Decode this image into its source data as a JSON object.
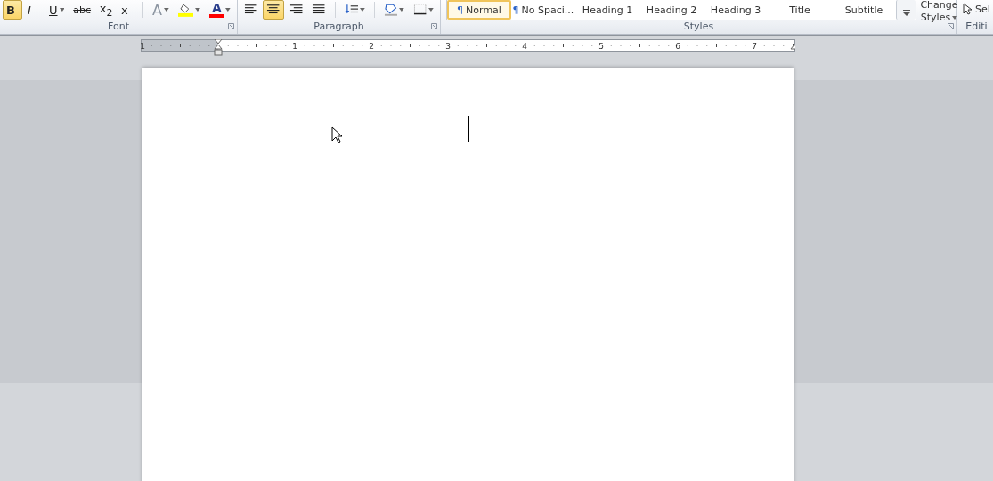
{
  "ribbon": {
    "groups": [
      {
        "kind": "font",
        "label": "Font",
        "buttons": [
          {
            "kind": "text",
            "text": "B",
            "selected": true,
            "dropdown": false
          },
          {
            "kind": "text",
            "text": "I",
            "selected": false,
            "dropdown": false
          },
          {
            "kind": "text",
            "text": "U",
            "selected": false,
            "dropdown": true
          },
          {
            "kind": "text",
            "text": "abc",
            "selected": false,
            "dropdown": false
          },
          {
            "kind": "text",
            "text": "x$_{2}$",
            "selected": false,
            "dropdown": false
          },
          {
            "kind": "text",
            "text": "x",
            "selected": false,
            "dropdown": false
          },
          {
            "kind": "effects",
            "text": "A",
            "selected": false,
            "dropdown": true
          },
          {
            "kind": "highlight",
            "selected": false,
            "dropdown": true
          },
          {
            "kind": "color",
            "text": "A",
            "selected": false,
            "dropdown": true
          }
        ]
      },
      {
        "kind": "paragraph",
        "label": "Paragraph",
        "buttons": [
          {
            "kind": "left",
            "selected": false,
            "dropdown": false
          },
          {
            "kind": "center",
            "selected": true,
            "dropdown": false
          },
          {
            "kind": "right",
            "selected": false,
            "dropdown": false
          },
          {
            "kind": "justify",
            "selected": false,
            "dropdown": false
          },
          {
            "kind": "spacing",
            "selected": false,
            "dropdown": true
          },
          {
            "kind": "shading",
            "selected": false,
            "dropdown": true
          },
          {
            "kind": "borders",
            "selected": false,
            "dropdown": true
          }
        ]
      },
      {
        "kind": "styles",
        "label": "Styles",
        "gallery": [
          {
            "symbol": "¶",
            "label": "Normal",
            "selected": true
          },
          {
            "symbol": "¶",
            "label": "No Spaci...",
            "selected": false
          },
          {
            "label": "Heading 1",
            "selected": false
          },
          {
            "label": "Heading 2",
            "selected": false
          },
          {
            "label": "Heading 3",
            "selected": false
          },
          {
            "label": "Title",
            "selected": false
          },
          {
            "label": "Subtitle",
            "selected": false
          }
        ],
        "change_styles": {
          "line_1": "Change",
          "line_2": "Styles"
        }
      },
      {
        "kind": "editing",
        "label": "Editi",
        "select": "Sel"
      }
    ]
  },
  "ruler": {
    "labels": [
      "1",
      "1",
      "2",
      "3",
      "4",
      "5",
      "6",
      "7"
    ]
  },
  "document": {
    "cursor": true
  }
}
